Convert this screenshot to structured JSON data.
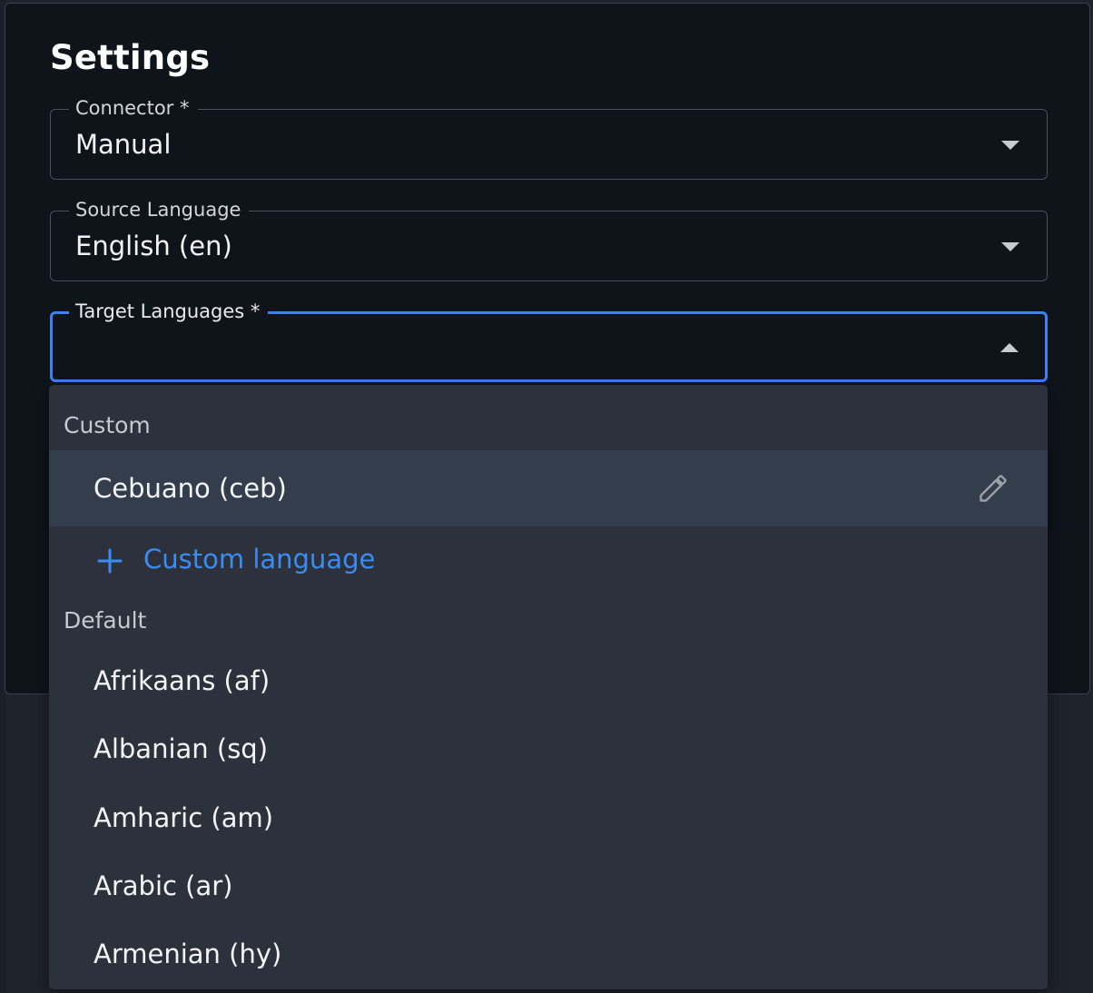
{
  "dialog": {
    "title": "Settings"
  },
  "fields": {
    "connector": {
      "label": "Connector *",
      "value": "Manual"
    },
    "source_language": {
      "label": "Source Language",
      "value": "English (en)"
    },
    "target_languages": {
      "label": "Target Languages *",
      "value": ""
    }
  },
  "menu": {
    "custom_header": "Custom",
    "custom_items": [
      {
        "label": "Cebuano (ceb)"
      }
    ],
    "add_custom_label": "Custom language",
    "default_header": "Default",
    "default_items": [
      {
        "label": "Afrikaans (af)"
      },
      {
        "label": "Albanian (sq)"
      },
      {
        "label": "Amharic (am)"
      },
      {
        "label": "Arabic (ar)"
      },
      {
        "label": "Armenian (hy)"
      }
    ]
  },
  "icons": {
    "dropdown": "chevron-down-icon",
    "dropdown_open": "chevron-up-icon",
    "edit": "pencil-icon",
    "add": "plus-icon"
  },
  "colors": {
    "accent": "#3b82f6",
    "link": "#3b8cf0",
    "dialog_bg": "#0f141b",
    "menu_bg": "#2c313b",
    "selected_bg": "#343d4c"
  }
}
